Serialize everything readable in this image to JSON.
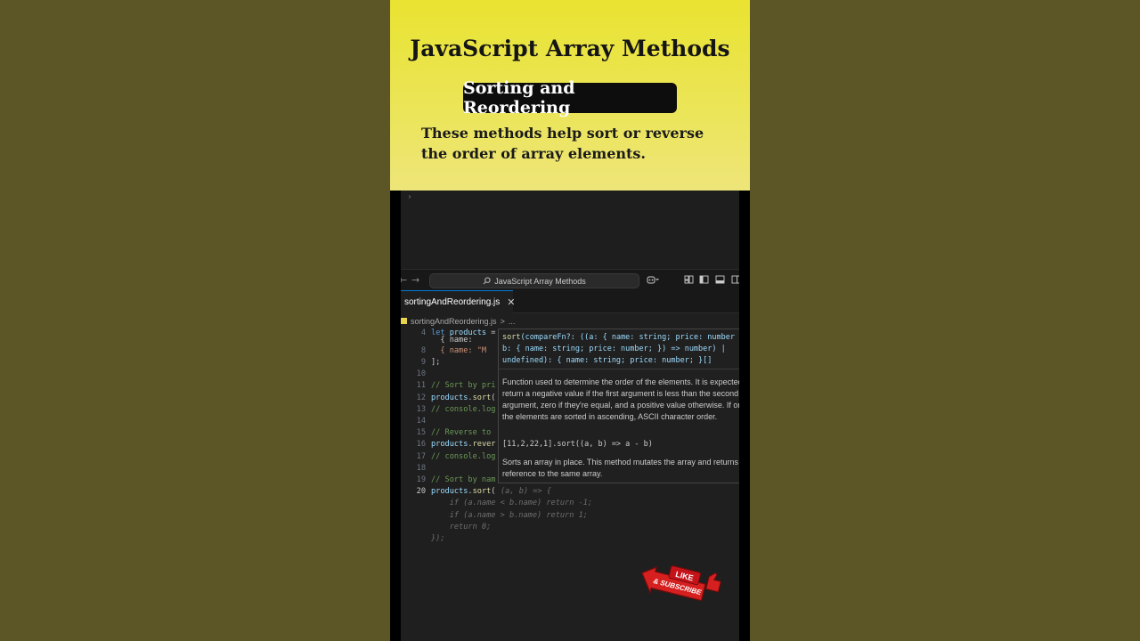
{
  "banner": {
    "title": "JavaScript Array Methods",
    "subtitle": "Sorting and Reordering",
    "description": "These methods help sort or reverse the order of array elements."
  },
  "titlebar": {
    "command_center": "JavaScript Array Methods"
  },
  "tab": {
    "filename": "sortingAndReordering.js",
    "close_glyph": "✕"
  },
  "breadcrumb": {
    "file": "sortingAndReordering.js",
    "separator": ">",
    "tail": "..."
  },
  "editor": {
    "lines": [
      {
        "num": "4",
        "text": "let products = ["
      },
      {
        "num": "",
        "text": "  { name: "
      },
      {
        "num": "8",
        "text": "  { name: \"M"
      },
      {
        "num": "9",
        "text": "];"
      },
      {
        "num": "10",
        "text": ""
      },
      {
        "num": "11",
        "text": "// Sort by pri"
      },
      {
        "num": "12",
        "text": "products.sort("
      },
      {
        "num": "13",
        "text": "// console.log"
      },
      {
        "num": "14",
        "text": ""
      },
      {
        "num": "15",
        "text": "// Reverse to"
      },
      {
        "num": "16",
        "text": "products.rever"
      },
      {
        "num": "17",
        "text": "// console.log"
      },
      {
        "num": "18",
        "text": ""
      },
      {
        "num": "19",
        "text": "// Sort by nam"
      },
      {
        "num": "20",
        "text": "products.sort("
      }
    ],
    "ghost_lines": [
      "(a, b) => {",
      "    if (a.name < b.name) return -1;",
      "    if (a.name > b.name) return 1;",
      "    return 0;",
      "});"
    ]
  },
  "hover": {
    "signature": [
      "sort(compareFn?: ((a: { name: string; price: number",
      "b: { name: string; price: number; }) => number) |",
      "undefined): { name: string; price: number; }[]"
    ],
    "doc": "Function used to determine the order of the elements. It is expected to return a negative value if the first argument is less than the second argument, zero if they're equal, and a positive value otherwise. If omitted, the elements are sorted in ascending, ASCII character order.",
    "example": "[11,2,22,1].sort((a, b) => a - b)",
    "note": "Sorts an array in place. This method mutates the array and returns a reference to the same array."
  },
  "sticker": {
    "like": "LIKE",
    "subscribe": "& SUBSCRIBE"
  },
  "colors": {
    "banner_yellow": "#eae331",
    "editor_bg": "#1f1f1f",
    "accent_blue": "#0078d4",
    "sticker_red": "#d62020"
  }
}
